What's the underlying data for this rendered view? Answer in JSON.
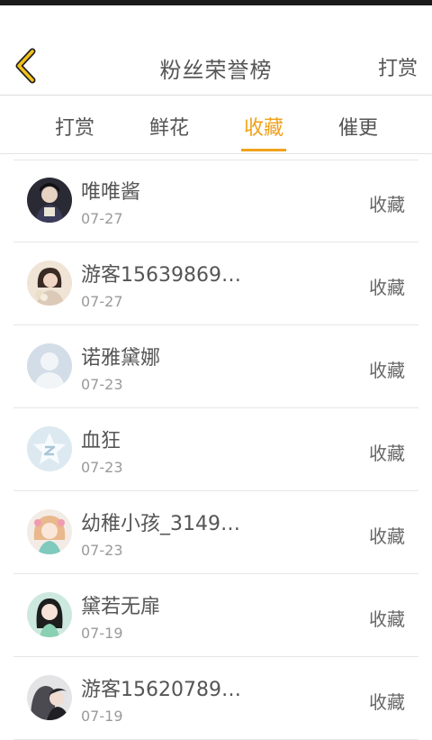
{
  "header": {
    "title": "粉丝荣誉榜",
    "action_label": "打赏"
  },
  "tabs": [
    {
      "label": "打赏",
      "active": false
    },
    {
      "label": "鲜花",
      "active": false
    },
    {
      "label": "收藏",
      "active": true
    },
    {
      "label": "催更",
      "active": false
    }
  ],
  "colors": {
    "accent": "#f0a21c",
    "text": "#555555",
    "secondary_text": "#9a9a9a"
  },
  "fans": [
    {
      "name": "唯唯酱",
      "date": "07-27",
      "action": "收藏",
      "avatar": "photo-avatar"
    },
    {
      "name": "游客15639869…",
      "date": "07-27",
      "action": "收藏",
      "avatar": "photo-avatar"
    },
    {
      "name": "诺雅黛娜",
      "date": "07-23",
      "action": "收藏",
      "avatar": "default-person-avatar"
    },
    {
      "name": "血狂",
      "date": "07-23",
      "action": "收藏",
      "avatar": "default-star-avatar"
    },
    {
      "name": "幼稚小孩_3149…",
      "date": "07-23",
      "action": "收藏",
      "avatar": "photo-avatar"
    },
    {
      "name": "黛若无扉",
      "date": "07-19",
      "action": "收藏",
      "avatar": "photo-avatar"
    },
    {
      "name": "游客15620789…",
      "date": "07-19",
      "action": "收藏",
      "avatar": "photo-avatar"
    }
  ]
}
